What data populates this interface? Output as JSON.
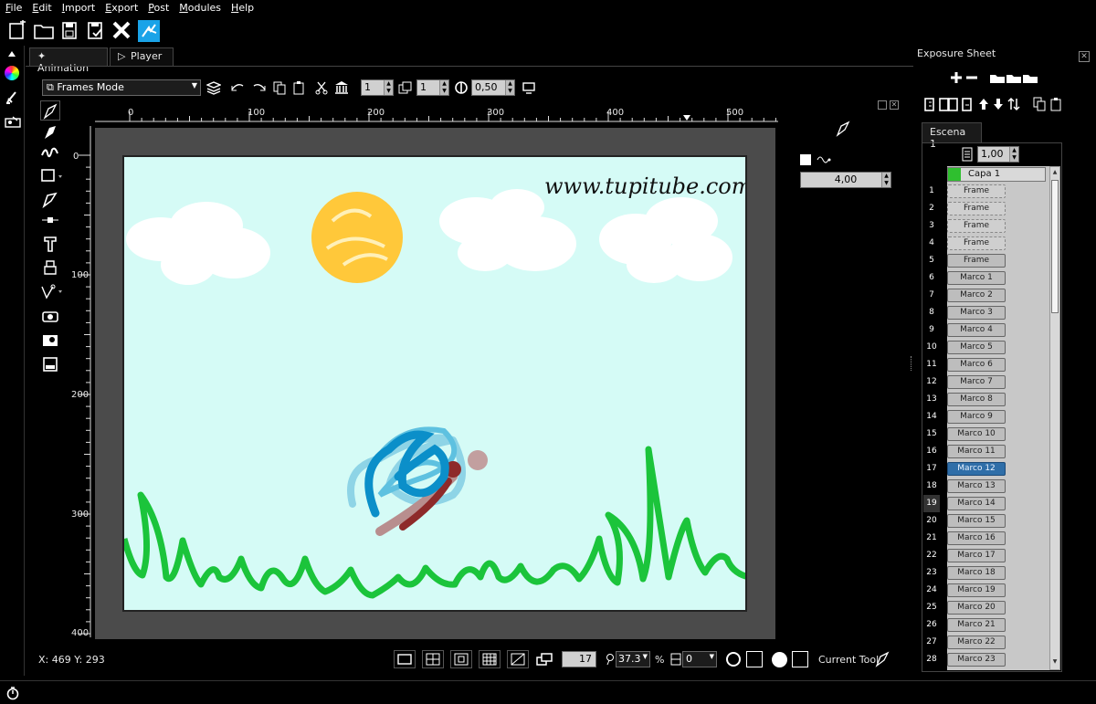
{
  "menu": {
    "items": [
      "File",
      "Edit",
      "Import",
      "Export",
      "Post",
      "Modules",
      "Help"
    ]
  },
  "toolbar": {
    "icons": [
      "new-project-icon",
      "open-folder-icon",
      "save-icon",
      "save-as-icon",
      "close-project-icon",
      "tupitube-logo-icon"
    ]
  },
  "tabs": [
    {
      "label": "Animation"
    },
    {
      "label": "Player"
    }
  ],
  "modebar": {
    "mode": "Frames Mode",
    "spin1": "1",
    "spin2": "1",
    "opacity": "0,50"
  },
  "ruler_top": [
    "0",
    "100",
    "200",
    "300",
    "400",
    "500"
  ],
  "ruler_left": [
    "0",
    "100",
    "200",
    "300",
    "400"
  ],
  "canvas": {
    "watermark": "www.tupitube.com"
  },
  "rightpanel": {
    "value": "4,00"
  },
  "status": {
    "coords": "X: 469 Y: 293",
    "frame": "17",
    "zoom": "37.3",
    "zoom_unit": "%",
    "rotation": "0",
    "current_tool": "Current Tool"
  },
  "exposure": {
    "title": "Exposure Sheet",
    "scene_tab": "Escena 1",
    "fps": "1,00",
    "layer": "Capa 1",
    "rows": [
      {
        "n": "1",
        "label": "Frame",
        "type": "frame"
      },
      {
        "n": "2",
        "label": "Frame",
        "type": "frame"
      },
      {
        "n": "3",
        "label": "Frame",
        "type": "frame"
      },
      {
        "n": "4",
        "label": "Frame",
        "type": "frame"
      },
      {
        "n": "5",
        "label": "Frame",
        "type": "cell"
      },
      {
        "n": "6",
        "label": "Marco 1",
        "type": "cell"
      },
      {
        "n": "7",
        "label": "Marco 2",
        "type": "cell"
      },
      {
        "n": "8",
        "label": "Marco 3",
        "type": "cell"
      },
      {
        "n": "9",
        "label": "Marco 4",
        "type": "cell"
      },
      {
        "n": "10",
        "label": "Marco 5",
        "type": "cell"
      },
      {
        "n": "11",
        "label": "Marco 6",
        "type": "cell"
      },
      {
        "n": "12",
        "label": "Marco 7",
        "type": "cell"
      },
      {
        "n": "13",
        "label": "Marco 8",
        "type": "cell"
      },
      {
        "n": "14",
        "label": "Marco 9",
        "type": "cell"
      },
      {
        "n": "15",
        "label": "Marco 10",
        "type": "cell"
      },
      {
        "n": "16",
        "label": "Marco 11",
        "type": "cell"
      },
      {
        "n": "17",
        "label": "Marco 12",
        "type": "sel"
      },
      {
        "n": "18",
        "label": "Marco 13",
        "type": "cell"
      },
      {
        "n": "19",
        "label": "Marco 14",
        "type": "cell"
      },
      {
        "n": "20",
        "label": "Marco 15",
        "type": "cell"
      },
      {
        "n": "21",
        "label": "Marco 16",
        "type": "cell"
      },
      {
        "n": "22",
        "label": "Marco 17",
        "type": "cell"
      },
      {
        "n": "23",
        "label": "Marco 18",
        "type": "cell"
      },
      {
        "n": "24",
        "label": "Marco 19",
        "type": "cell"
      },
      {
        "n": "25",
        "label": "Marco 20",
        "type": "cell"
      },
      {
        "n": "26",
        "label": "Marco 21",
        "type": "cell"
      },
      {
        "n": "27",
        "label": "Marco 22",
        "type": "cell"
      },
      {
        "n": "28",
        "label": "Marco 23",
        "type": "cell"
      }
    ]
  },
  "colors": {
    "grass": "#1bc43b",
    "sun": "#ffc83a",
    "sky": "#d5fbf6",
    "selected_cell": "#2f6ea8",
    "layer_color": "#2fbf2f"
  }
}
